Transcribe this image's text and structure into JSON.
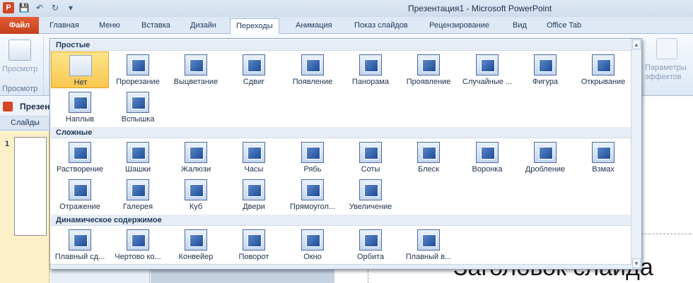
{
  "window": {
    "title": "Презентация1 - Microsoft PowerPoint"
  },
  "quick_access": [
    "save-icon",
    "undo-icon",
    "redo-icon",
    "customize-icon"
  ],
  "ribbon_tabs": [
    {
      "label": "Файл"
    },
    {
      "label": "Главная"
    },
    {
      "label": "Меню"
    },
    {
      "label": "Вставка"
    },
    {
      "label": "Дизайн"
    },
    {
      "label": "Переходы",
      "active": true
    },
    {
      "label": "Анимация"
    },
    {
      "label": "Показ слайдов"
    },
    {
      "label": "Рецензирование"
    },
    {
      "label": "Вид"
    },
    {
      "label": "Office Tab"
    }
  ],
  "ribbon": {
    "preview_label": "Просмотр",
    "preview_group": "Просмотр",
    "effects_label": "Параметры эффектов"
  },
  "document": {
    "name": "Презен"
  },
  "slides_pane": {
    "tab_label": "Слайды",
    "slide_number": "1"
  },
  "slide": {
    "title": "Заголовок слайда"
  },
  "gallery": {
    "sections": [
      {
        "title": "Простые",
        "items": [
          {
            "label": "Нет",
            "selected": true
          },
          {
            "label": "Прорезание"
          },
          {
            "label": "Выцветание"
          },
          {
            "label": "Сдвиг"
          },
          {
            "label": "Появление"
          },
          {
            "label": "Панорама"
          },
          {
            "label": "Проявление"
          },
          {
            "label": "Случайные ..."
          },
          {
            "label": "Фигура"
          },
          {
            "label": "Открывание"
          },
          {
            "label": "Наплыв"
          },
          {
            "label": "Вспышка"
          }
        ]
      },
      {
        "title": "Сложные",
        "items": [
          {
            "label": "Растворение"
          },
          {
            "label": "Шашки"
          },
          {
            "label": "Жалюзи"
          },
          {
            "label": "Часы"
          },
          {
            "label": "Рябь"
          },
          {
            "label": "Соты"
          },
          {
            "label": "Блеск"
          },
          {
            "label": "Воронка"
          },
          {
            "label": "Дробление"
          },
          {
            "label": "Взмах"
          },
          {
            "label": "Отражение"
          },
          {
            "label": "Галерея"
          },
          {
            "label": "Куб"
          },
          {
            "label": "Двери"
          },
          {
            "label": "Прямоугол..."
          },
          {
            "label": "Увеличение"
          }
        ]
      },
      {
        "title": "Динамическое содержимое",
        "items": [
          {
            "label": "Плавный сд..."
          },
          {
            "label": "Чертово ко..."
          },
          {
            "label": "Конвейер"
          },
          {
            "label": "Поворот"
          },
          {
            "label": "Окно"
          },
          {
            "label": "Орбита"
          },
          {
            "label": "Плавный в..."
          }
        ]
      }
    ]
  }
}
